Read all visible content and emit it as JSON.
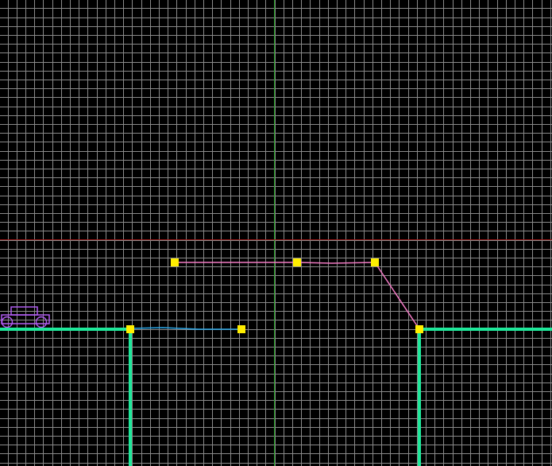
{
  "colors": {
    "background": "#000000",
    "grid_line": "#8a8a8a",
    "vertical_axis": "#1f9e1f",
    "horizontal_axis": "#a01c1c",
    "ground_terrain": "#1ee89a",
    "bridge_deck": "#2aa7e8",
    "ramp_path": "#f27ac4",
    "control_node": "#ffee00",
    "vehicle_outline": "#b05cf0"
  },
  "icons": {
    "vehicle": "car-outline-icon",
    "node": "control-point-square"
  }
}
